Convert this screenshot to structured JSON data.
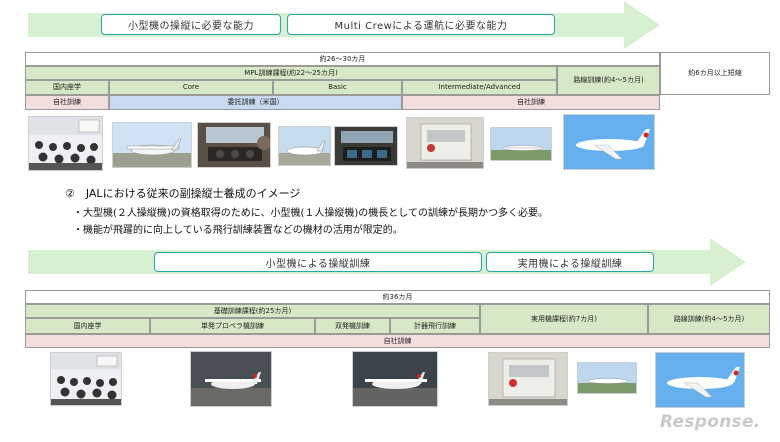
{
  "top": {
    "pills": [
      "小型機の操縦に必要な能力",
      "Multi Crewによる運航に必要な能力"
    ],
    "row_total": "約26～30カ月",
    "row_mpl": "MPL訓練課程(約22～25カ月)",
    "row_route": "路線訓練(約4～5カ月)",
    "row_shorter": "約6カ月以上短縮",
    "phases": [
      "国内座学",
      "Core",
      "Basic",
      "Intermediate/Advanced"
    ],
    "bands": [
      "自社訓練",
      "委託訓練（米国）",
      "自社訓練"
    ]
  },
  "section": {
    "title": "②　JALにおける従来の副操縦士養成のイメージ",
    "bullets": [
      "・大型機(２人操縦機)の資格取得のために、小型機(１人操縦機)の機長としての訓練が長期かつ多く必要。",
      "・機能が飛躍的に向上している飛行訓練装置などの機材の活用が限定的。"
    ]
  },
  "bottom": {
    "pills": [
      "小型機による操縦訓練",
      "実用機による操縦訓練"
    ],
    "row_total": "約36カ月",
    "row_basic": "基礎訓練課程(約25カ月)",
    "row_jet": "実用機課程(約7カ月)",
    "row_route": "路線訓練(約4～5カ月)",
    "phases": [
      "国内座学",
      "単発プロペラ機訓練",
      "双発機訓練",
      "計器飛行訓練"
    ],
    "band": "自社訓練"
  },
  "logo": "Response."
}
